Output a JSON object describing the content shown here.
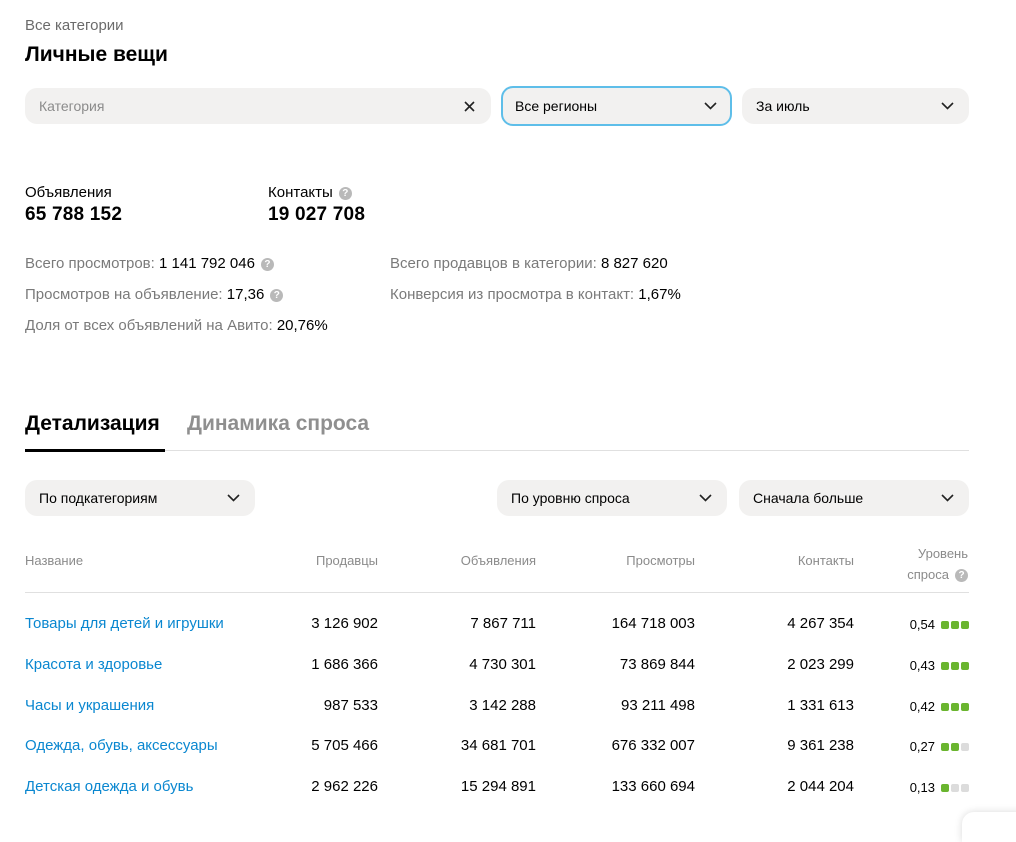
{
  "breadcrumb": "Все категории",
  "title": "Личные вещи",
  "filters": {
    "category_placeholder": "Категория",
    "region": "Все регионы",
    "period": "За июль"
  },
  "metrics": {
    "ads_label": "Объявления",
    "ads_value": "65 788 152",
    "contacts_label": "Контакты",
    "contacts_value": "19 027 708"
  },
  "stats": {
    "total_views_label": "Всего просмотров:",
    "total_views_value": "1 141 792 046",
    "views_per_ad_label": "Просмотров на объявление:",
    "views_per_ad_value": "17,36",
    "share_label": "Доля от всех объявлений на Авито:",
    "share_value": "20,76%",
    "sellers_label": "Всего продавцов в категории:",
    "sellers_value": "8 827 620",
    "conversion_label": "Конверсия из просмотра в контакт:",
    "conversion_value": "1,67%"
  },
  "tabs": [
    {
      "label": "Детализация",
      "active": true
    },
    {
      "label": "Динамика спроса",
      "active": false
    }
  ],
  "table_filters": {
    "group_by": "По подкатегориям",
    "sort_by": "По уровню спроса",
    "order": "Сначала больше"
  },
  "table": {
    "headers": {
      "name": "Название",
      "sellers": "Продавцы",
      "ads": "Объявления",
      "views": "Просмотры",
      "contacts": "Контакты",
      "demand_line1": "Уровень",
      "demand_line2": "спроса"
    },
    "rows": [
      {
        "name": "Товары для детей и игрушки",
        "sellers": "3 126 902",
        "ads": "7 867 711",
        "views": "164 718 003",
        "contacts": "4 267 354",
        "demand": "0,54",
        "level": 3
      },
      {
        "name": "Красота и здоровье",
        "sellers": "1 686 366",
        "ads": "4 730 301",
        "views": "73 869 844",
        "contacts": "2 023 299",
        "demand": "0,43",
        "level": 3
      },
      {
        "name": "Часы и украшения",
        "sellers": "987 533",
        "ads": "3 142 288",
        "views": "93 211 498",
        "contacts": "1 331 613",
        "demand": "0,42",
        "level": 3
      },
      {
        "name": "Одежда, обувь, аксессуары",
        "sellers": "5 705 466",
        "ads": "34 681 701",
        "views": "676 332 007",
        "contacts": "9 361 238",
        "demand": "0,27",
        "level": 2
      },
      {
        "name": "Детская одежда и обувь",
        "sellers": "2 962 226",
        "ads": "15 294 891",
        "views": "133 660 694",
        "contacts": "2 044 204",
        "demand": "0,13",
        "level": 1
      }
    ]
  },
  "colors": {
    "link": "#0a87d0",
    "demand_on": "#6ab52f",
    "demand_off": "#dcdcdc",
    "focus_border": "#5ebee9"
  }
}
